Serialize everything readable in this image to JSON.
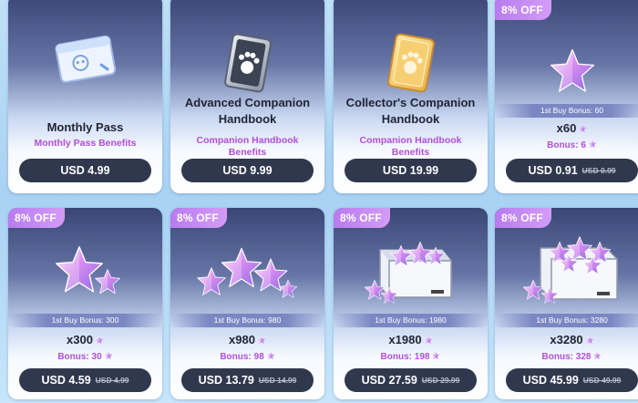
{
  "top_cards": [
    {
      "title": "Monthly Pass",
      "subtitle": "Monthly Pass Benefits",
      "price": "USD 4.99",
      "icon": "pass-card-icon"
    },
    {
      "title": "Advanced Companion Handbook",
      "subtitle": "Companion Handbook Benefits",
      "price": "USD 9.99",
      "icon": "silver-paw-card-icon"
    },
    {
      "title": "Collector's Companion Handbook",
      "subtitle": "Companion Handbook Benefits",
      "price": "USD 19.99",
      "icon": "gold-paw-card-icon"
    },
    {
      "badge": "8% OFF",
      "first_buy": "1st Buy Bonus:",
      "first_buy_value": "60",
      "qty": "x60",
      "bonus": "Bonus: 6",
      "price": "USD 0.91",
      "old_price": "USD 0.99",
      "icon": "star-gem-icon"
    }
  ],
  "bottom_cards": [
    {
      "badge": "8% OFF",
      "first_buy": "1st Buy Bonus:",
      "first_buy_value": "300",
      "qty": "x300",
      "bonus": "Bonus: 30",
      "price": "USD 4.59",
      "old_price": "USD 4.99",
      "icon": "star-gem-pair-icon"
    },
    {
      "badge": "8% OFF",
      "first_buy": "1st Buy Bonus:",
      "first_buy_value": "980",
      "qty": "x980",
      "bonus": "Bonus: 98",
      "price": "USD 13.79",
      "old_price": "USD 14.99",
      "icon": "star-gem-cluster-icon"
    },
    {
      "badge": "8% OFF",
      "first_buy": "1st Buy Bonus:",
      "first_buy_value": "1980",
      "qty": "x1980",
      "bonus": "Bonus: 198",
      "price": "USD 27.59",
      "old_price": "USD 29.99",
      "icon": "star-gem-box-icon"
    },
    {
      "badge": "8% OFF",
      "first_buy": "1st Buy Bonus:",
      "first_buy_value": "3280",
      "qty": "x3280",
      "bonus": "Bonus: 328",
      "price": "USD 45.99",
      "old_price": "USD 49.99",
      "icon": "star-gem-big-box-icon"
    }
  ],
  "colors": {
    "price_button": "#30384e",
    "accent_purple": "#b24fd8",
    "badge": "#c48af3"
  }
}
